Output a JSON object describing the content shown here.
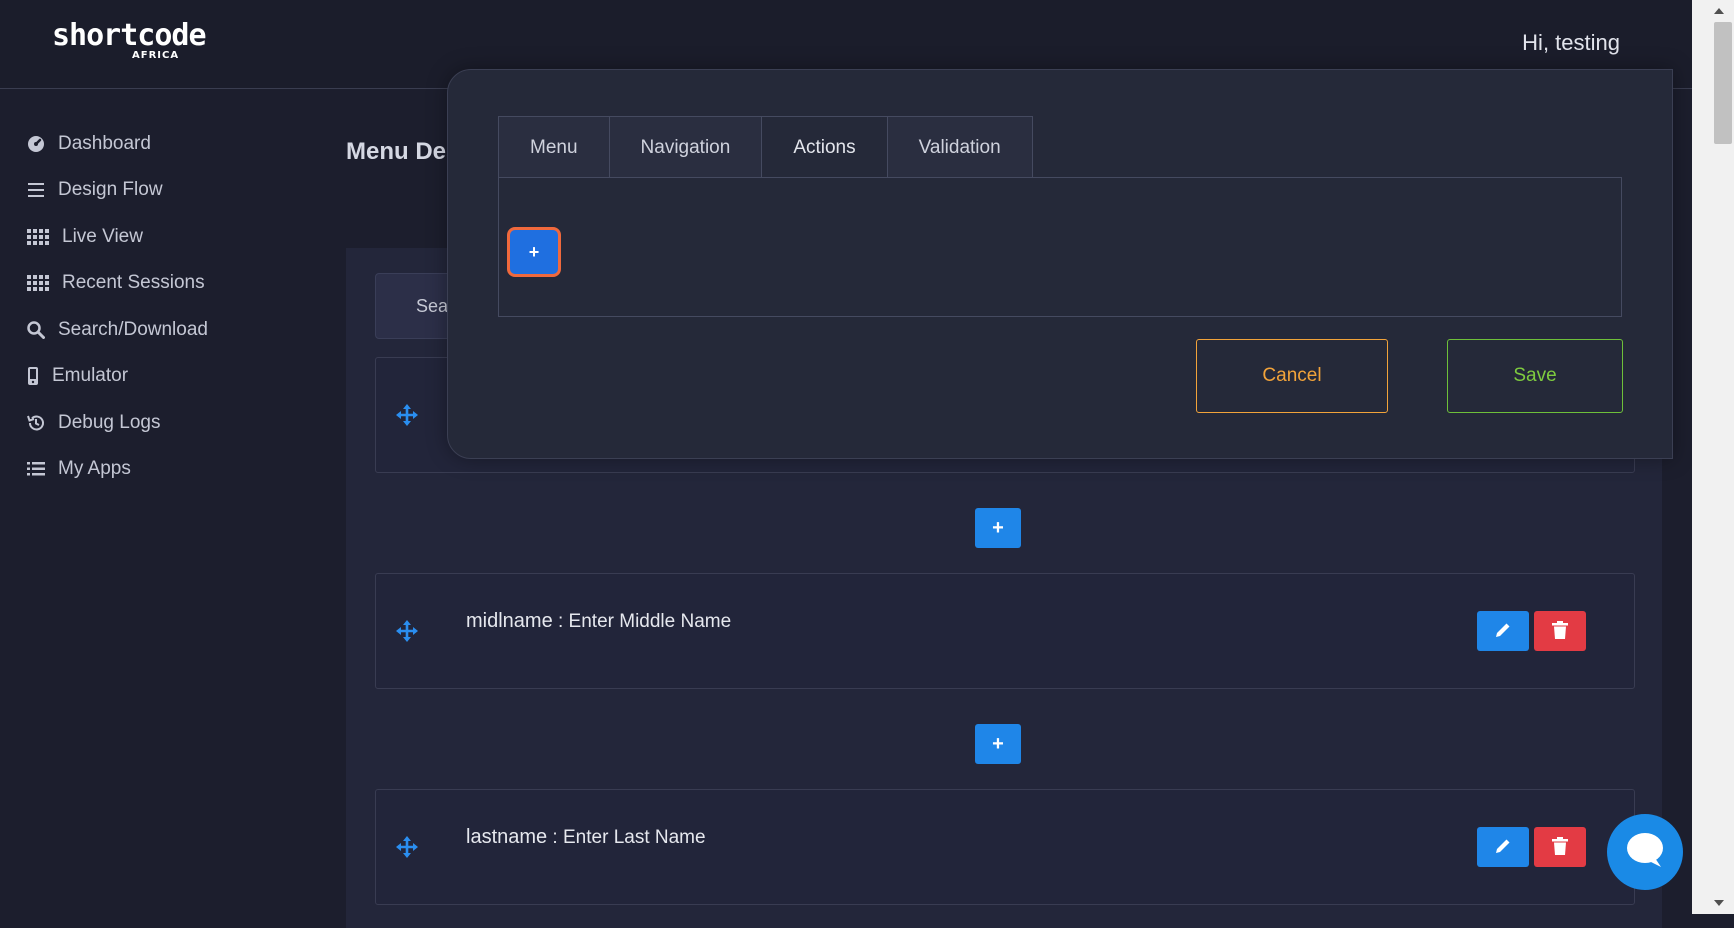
{
  "header": {
    "logo_main": "shortcode",
    "logo_sub": "AFRICA",
    "greeting": "Hi, testing"
  },
  "sidebar": {
    "items": [
      {
        "label": "Dashboard",
        "icon": "dashboard-icon"
      },
      {
        "label": "Design Flow",
        "icon": "bars-icon"
      },
      {
        "label": "Live View",
        "icon": "grid-icon"
      },
      {
        "label": "Recent Sessions",
        "icon": "grid-icon"
      },
      {
        "label": "Search/Download",
        "icon": "search-icon"
      },
      {
        "label": "Emulator",
        "icon": "phone-icon"
      },
      {
        "label": "Debug Logs",
        "icon": "history-icon"
      },
      {
        "label": "My Apps",
        "icon": "list-icon"
      }
    ]
  },
  "main": {
    "title": "Menu Des",
    "search_label": "Sear",
    "items": [
      {
        "key": "",
        "value": ""
      },
      {
        "key": "midlname",
        "value": "Enter Middle Name"
      },
      {
        "key": "lastname",
        "value": "Enter Last Name"
      }
    ],
    "add_label": "+"
  },
  "modal": {
    "tabs": [
      "Menu",
      "Navigation",
      "Actions",
      "Validation"
    ],
    "active_tab": "Actions",
    "add_label": "+",
    "cancel_label": "Cancel",
    "save_label": "Save"
  },
  "colors": {
    "accent": "#1f86e8",
    "danger": "#e33b44",
    "cancel": "#f2a33a",
    "save": "#7ecb3f",
    "highlight": "#f0693d"
  }
}
